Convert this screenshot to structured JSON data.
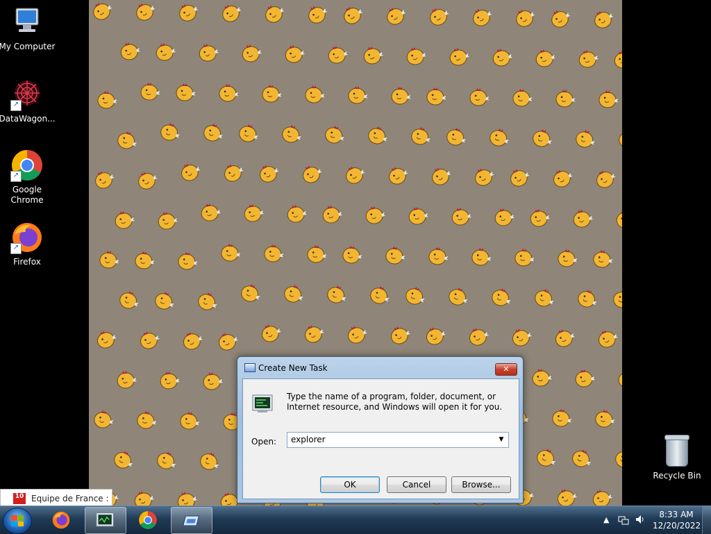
{
  "desktop": {
    "icons": [
      {
        "label": "My Computer"
      },
      {
        "label": "DataWagon..."
      },
      {
        "label": "Google Chrome"
      },
      {
        "label": "Firefox"
      }
    ],
    "recycle_bin": {
      "label": "Recycle Bin"
    }
  },
  "dialog": {
    "title": "Create New Task",
    "close_symbol": "✕",
    "description": "Type the name of a program, folder, document, or Internet resource, and Windows will open it for you.",
    "open_label": "Open:",
    "open_value": "explorer",
    "buttons": {
      "ok": "OK",
      "cancel": "Cancel",
      "browse": "Browse..."
    }
  },
  "notification": {
    "logo": "10",
    "text": "Equipe de France : Ab"
  },
  "taskbar": {
    "items": [
      {
        "icon": "firefox-icon"
      },
      {
        "icon": "task-manager-icon",
        "active": true
      },
      {
        "icon": "chrome-icon"
      },
      {
        "icon": "run-dialog-icon",
        "active": true
      }
    ],
    "clock": {
      "time": "8:33 AM",
      "date": "12/20/2022"
    }
  },
  "colors": {
    "wallpaper": "#8f8579",
    "chick": "#f2b632",
    "taskbar": "#203a55",
    "close": "#c7402d"
  }
}
